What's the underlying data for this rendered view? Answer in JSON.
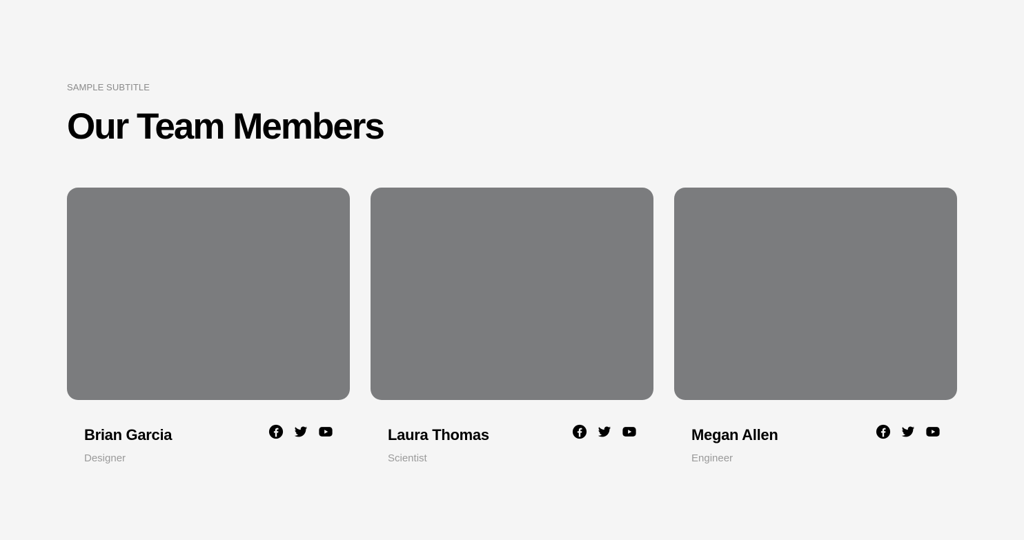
{
  "section": {
    "subtitle": "SAMPLE SUBTITLE",
    "title": "Our Team Members"
  },
  "members": [
    {
      "name": "Brian Garcia",
      "role": "Designer",
      "social": [
        "facebook-icon",
        "twitter-icon",
        "youtube-icon"
      ]
    },
    {
      "name": "Laura Thomas",
      "role": "Scientist",
      "social": [
        "facebook-icon",
        "twitter-icon",
        "youtube-icon"
      ]
    },
    {
      "name": "Megan Allen",
      "role": "Engineer",
      "social": [
        "facebook-icon",
        "twitter-icon",
        "youtube-icon"
      ]
    }
  ],
  "colors": {
    "background": "#f5f5f5",
    "photo_placeholder": "#7b7c7e",
    "muted_text": "#9a9a9a",
    "heading_text": "#000000"
  }
}
